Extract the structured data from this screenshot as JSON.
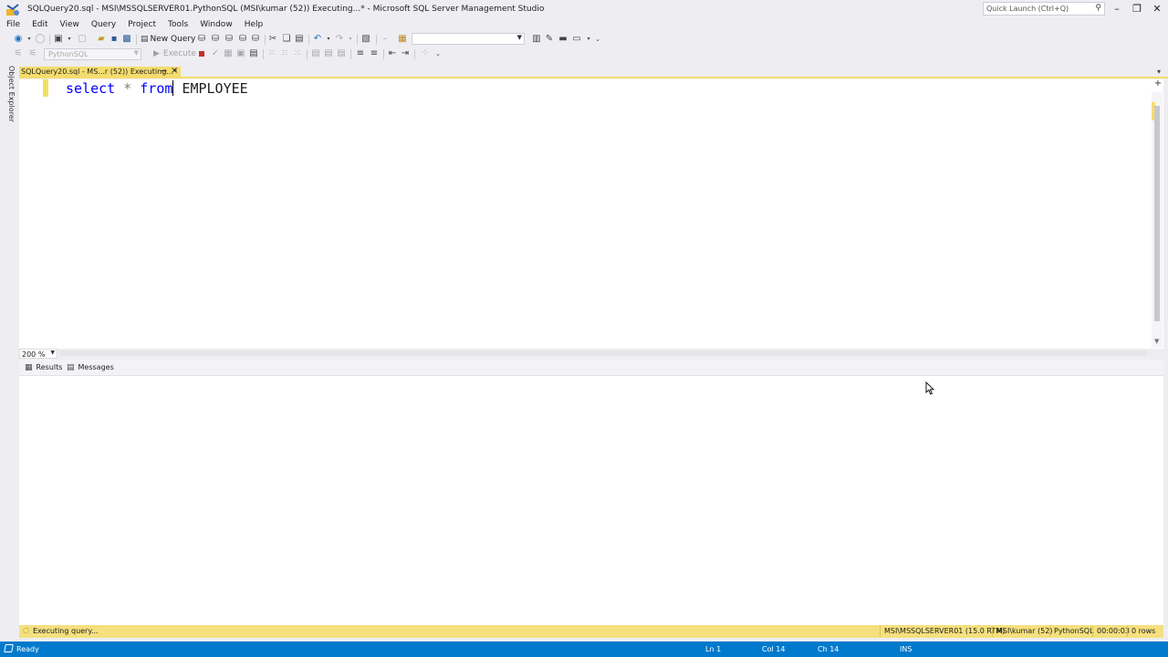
{
  "window": {
    "title": "SQLQuery20.sql - MSI\\MSSQLSERVER01.PythonSQL (MSI\\kumar (52)) Executing...* - Microsoft SQL Server Management Studio",
    "quick_launch_placeholder": "Quick Launch (Ctrl+Q)",
    "minimize_icon": "minimize-icon",
    "restore_icon": "restore-icon",
    "close_icon": "close-icon"
  },
  "menu": [
    "File",
    "Edit",
    "View",
    "Query",
    "Project",
    "Tools",
    "Window",
    "Help"
  ],
  "toolbar": {
    "new_query_label": "New Query",
    "database": "PythonSQL",
    "execute_label": "Execute"
  },
  "side_panel": {
    "object_explorer": "Object Explorer"
  },
  "document_tab": {
    "label": "SQLQuery20.sql - MS...r (52)) Executing...*",
    "pin_icon": "pin-icon",
    "close_icon": "close-icon"
  },
  "editor": {
    "code": {
      "keyword1": "select",
      "operator": "*",
      "keyword2": "from",
      "identifier": "EMPLOYEE"
    },
    "zoom": "200 %"
  },
  "results": {
    "tabs": [
      {
        "label": "Results",
        "icon": "grid-icon"
      },
      {
        "label": "Messages",
        "icon": "messages-icon"
      }
    ]
  },
  "query_status": {
    "message": "Executing query...",
    "server": "MSI\\MSSQLSERVER01 (15.0 RTM)",
    "user": "MSI\\kumar (52)",
    "database": "PythonSQL",
    "elapsed": "00:00:03",
    "rows": "0 rows"
  },
  "status_bar": {
    "state": "Ready",
    "line": "Ln 1",
    "col": "Col 14",
    "ch": "Ch 14",
    "mode": "INS"
  },
  "colors": {
    "accent": "#007acc",
    "keyword": "#0000ff",
    "tab_active": "#f5dc6e"
  }
}
